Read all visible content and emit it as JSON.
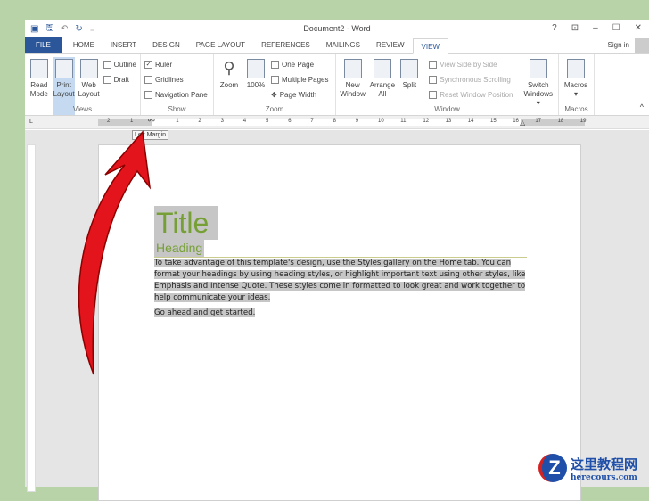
{
  "window": {
    "title": "Document2 - Word",
    "help": "?",
    "restore_ribbon": "⊡",
    "minimize": "–",
    "maximize": "☐",
    "close": "✕",
    "sign_in": "Sign in"
  },
  "quick_access": [
    "word-icon",
    "save-icon",
    "undo-icon",
    "redo-icon",
    "customize-icon"
  ],
  "tabs": [
    "FILE",
    "HOME",
    "INSERT",
    "DESIGN",
    "PAGE LAYOUT",
    "REFERENCES",
    "MAILINGS",
    "REVIEW",
    "VIEW"
  ],
  "active_tab": "VIEW",
  "ribbon": {
    "views": {
      "label": "Views",
      "read": [
        "Read",
        "Mode"
      ],
      "print": [
        "Print",
        "Layout"
      ],
      "web": [
        "Web",
        "Layout"
      ],
      "outline": "Outline",
      "draft": "Draft"
    },
    "show": {
      "label": "Show",
      "ruler": "Ruler",
      "ruler_checked": true,
      "gridlines": "Gridlines",
      "gridlines_checked": false,
      "nav": "Navigation Pane",
      "nav_checked": false
    },
    "zoom": {
      "label": "Zoom",
      "zoom": "Zoom",
      "hundred": "100%",
      "one": "One Page",
      "multi": "Multiple Pages",
      "width": "Page Width"
    },
    "window": {
      "label": "Window",
      "new": [
        "New",
        "Window"
      ],
      "arrange": [
        "Arrange",
        "All"
      ],
      "split": "Split",
      "side": "View Side by Side",
      "sync": "Synchronous Scrolling",
      "reset": "Reset Window Position",
      "switch": [
        "Switch",
        "Windows ▾"
      ]
    },
    "macros": {
      "label": "Macros",
      "macros": "Macros",
      "arrow": "▾"
    },
    "collapse": "^"
  },
  "ruler": {
    "corner": "L",
    "ticks": [
      "2",
      "1",
      "1",
      "2",
      "3",
      "4",
      "5",
      "6",
      "7",
      "8",
      "9",
      "10",
      "11",
      "12",
      "13",
      "14",
      "15",
      "16",
      "17",
      "18",
      "19"
    ],
    "tooltip": "Left Margin"
  },
  "document": {
    "title": "Title",
    "heading": "Heading",
    "paragraph": "To take advantage of this template's design, use the Styles gallery on the Home tab. You can format your headings by using heading styles, or highlight important text using other styles, like Emphasis and Intense Quote. These styles come in formatted to look great and work together to help communicate your ideas.",
    "paragraph2": "Go ahead and get started."
  },
  "watermark": {
    "cn": "这里教程网",
    "en": "herecours.com",
    "logo": "Z"
  },
  "colors": {
    "accent": "#2b579a",
    "heading": "#76a035",
    "arrow": "#e3141b"
  }
}
